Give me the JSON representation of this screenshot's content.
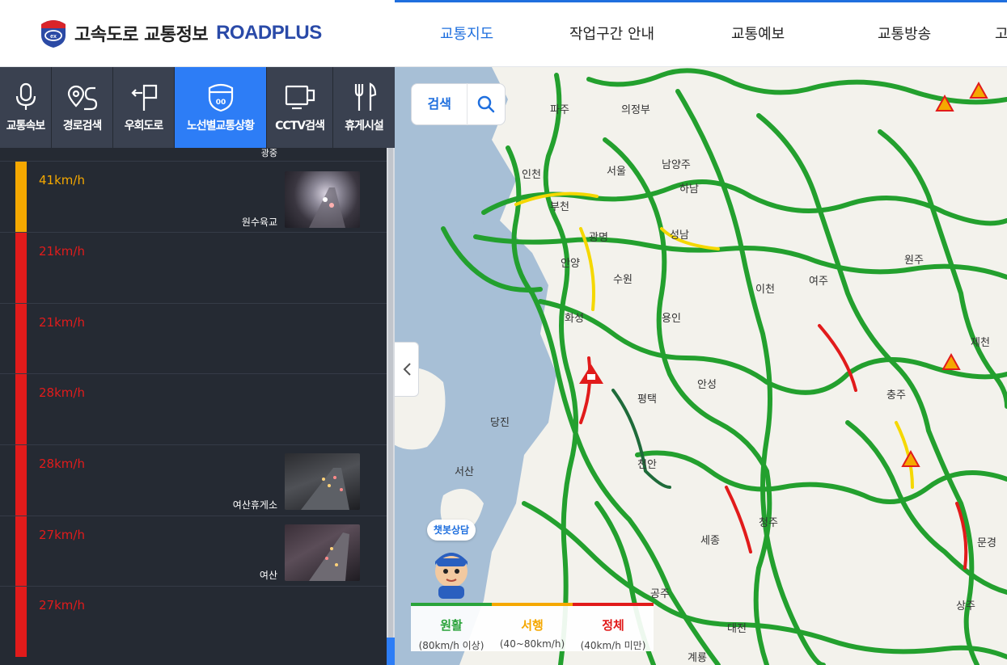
{
  "header": {
    "logo_kr": "고속도로 교통정보",
    "logo_en": "ROADPLUS",
    "menu": [
      "교통지도",
      "작업구간 안내",
      "교통예보",
      "교통방송",
      "고"
    ]
  },
  "tabs": [
    "교통속보",
    "경로검색",
    "우회도로",
    "노선별교통상황",
    "CCTV검색",
    "휴게시설"
  ],
  "active_tab": "노선별교통상황",
  "top_partial_camera": "광중",
  "segments": [
    {
      "speed": "41km/h",
      "status": "slow",
      "camera": "원수육교"
    },
    {
      "speed": "21km/h",
      "status": "jam",
      "camera": ""
    },
    {
      "speed": "21km/h",
      "status": "jam",
      "camera": ""
    },
    {
      "speed": "28km/h",
      "status": "jam",
      "camera": ""
    },
    {
      "speed": "28km/h",
      "status": "jam",
      "camera": "여산휴게소"
    },
    {
      "speed": "27km/h",
      "status": "jam",
      "camera": "여산"
    },
    {
      "speed": "27km/h",
      "status": "jam",
      "camera": ""
    }
  ],
  "colors": {
    "smooth": "#2aa33a",
    "slow": "#f5a800",
    "jam": "#e11b1b",
    "accent": "#2d7df6",
    "sidebar": "#252a33"
  },
  "map": {
    "search_label": "검색",
    "chatbot_label": "챗봇상담",
    "legend": [
      {
        "name": "원활",
        "range": "(80km/h 이상)",
        "color": "#2aa33a"
      },
      {
        "name": "서행",
        "range": "(40~80km/h)",
        "color": "#f5a800"
      },
      {
        "name": "정체",
        "range": "(40km/h 미만)",
        "color": "#e11b1b"
      }
    ],
    "places": [
      "파주",
      "의정부",
      "인천",
      "서울",
      "남양주",
      "하남",
      "부천",
      "성남",
      "광명",
      "안양",
      "수원",
      "원주",
      "여주",
      "이천",
      "화성",
      "용인",
      "제천",
      "평택",
      "안성",
      "충주",
      "당진",
      "서산",
      "천안",
      "청주",
      "세종",
      "문경",
      "공주",
      "대전",
      "상주",
      "계룡"
    ]
  }
}
